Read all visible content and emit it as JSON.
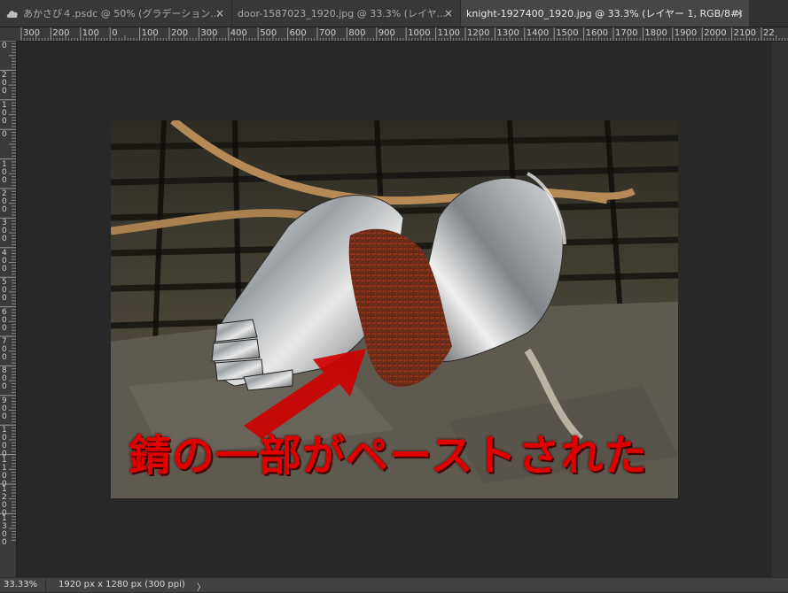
{
  "tabs": [
    {
      "label": "あかさび４.psdc @ 50% (グラデーション...",
      "active": false,
      "icon": "cloud-icon"
    },
    {
      "label": "door-1587023_1920.jpg @ 33.3% (レイヤ...",
      "active": false
    },
    {
      "label": "knight-1927400_1920.jpg @ 33.3% (レイヤー 1, RGB/8#) *",
      "active": true
    }
  ],
  "tab_close_glyph": "×",
  "ruler_top_labels": [
    "300",
    "200",
    "100",
    "0",
    "100",
    "200",
    "300",
    "400",
    "500",
    "600",
    "700",
    "800",
    "900",
    "1000",
    "1100",
    "1200",
    "1300",
    "1400",
    "1500",
    "1600",
    "1700",
    "1800",
    "1900",
    "2000",
    "2100",
    "22"
  ],
  "ruler_left_labels": [
    "0",
    "200",
    "100",
    "0",
    "100",
    "200",
    "300",
    "400",
    "500",
    "600",
    "700",
    "800",
    "900",
    "1000",
    "1100",
    "1200",
    "1300"
  ],
  "canvas": {
    "image_caption": "錆の一部がペーストされた",
    "colors": {
      "caption": "#e00000",
      "arrow": "#d00000",
      "rust": "#7a2a14",
      "background": "#282828"
    }
  },
  "status": {
    "zoom": "33.33%",
    "doc_info": "1920 px x 1280 px (300 ppi)",
    "arrow_glyph": "〉"
  }
}
